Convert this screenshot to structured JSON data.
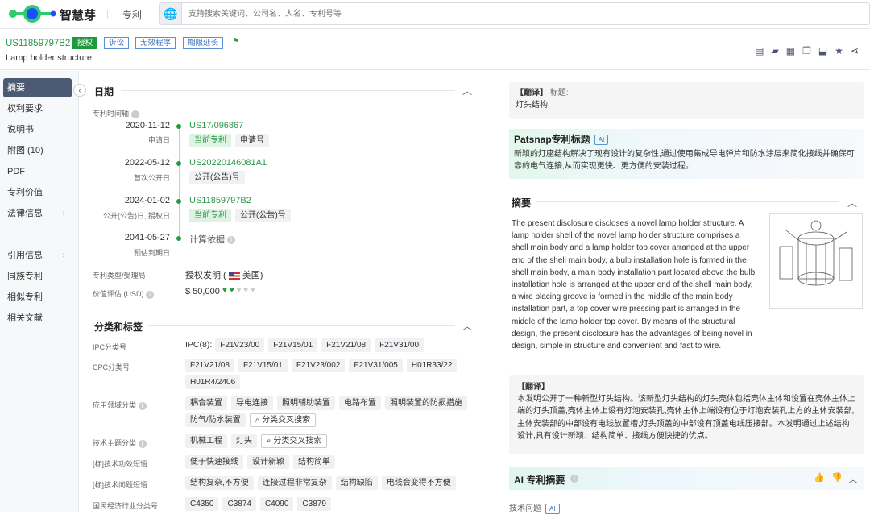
{
  "topbar": {
    "brand": "智慧芽",
    "module": "专利",
    "search_placeholder": "支持搜索关键词、公司名、人名、专利号等"
  },
  "header": {
    "patent_number": "US11859797B2",
    "tags": [
      "授权",
      "诉讼",
      "无效程序",
      "期限延长"
    ],
    "title": "Lamp holder structure"
  },
  "toolbar_icons": [
    "pdf-download-icon",
    "folder-icon",
    "document-icon",
    "copy-icon",
    "export-icon",
    "star-icon",
    "share-icon"
  ],
  "sidebar": {
    "items": [
      {
        "label": "摘要"
      },
      {
        "label": "权利要求"
      },
      {
        "label": "说明书"
      },
      {
        "label": "附图 (10)"
      },
      {
        "label": "PDF"
      },
      {
        "label": "专利价值"
      },
      {
        "label": "法律信息"
      },
      {
        "label": "引用信息"
      },
      {
        "label": "同族专利"
      },
      {
        "label": "相似专利"
      },
      {
        "label": "相关文献"
      }
    ]
  },
  "dates": {
    "heading": "日期",
    "timeline_label": "专利时间轴",
    "timeline": [
      {
        "date": "2020-11-12",
        "desc": "申请日",
        "number": "US17/096867",
        "chips": [
          "当前专利",
          "申请号"
        ]
      },
      {
        "date": "2022-05-12",
        "desc": "首次公开日",
        "number": "US20220146081A1",
        "chips": [
          "公开(公告)号"
        ]
      },
      {
        "date": "2024-01-02",
        "desc": "公开(公告)日, 授权日",
        "number": "US11859797B2",
        "chips": [
          "当前专利",
          "公开(公告)号"
        ]
      },
      {
        "date": "2041-05-27",
        "desc": "预估到期日",
        "number": "计算依据",
        "chips": []
      }
    ],
    "type_label": "专利类型/受理局",
    "type_value": "授权发明 (",
    "office": "美国)",
    "value_label": "价值评估 (USD)",
    "value": "$ 50,000",
    "value_rating": 1.5,
    "value_max": 5
  },
  "classification": {
    "heading": "分类和标签",
    "ipc_label": "IPC分类号",
    "ipc_prefix": "IPC(8):",
    "ipc": [
      "F21V23/00",
      "F21V15/01",
      "F21V21/08",
      "F21V31/00"
    ],
    "cpc_label": "CPC分类号",
    "cpc": [
      "F21V21/08",
      "F21V15/01",
      "F21V23/002",
      "F21V31/005",
      "H01R33/22",
      "H01R4/2406"
    ],
    "app_label": "应用领域分类",
    "app": [
      "耦合装置",
      "导电连接",
      "照明辅助装置",
      "电路布置",
      "照明装置的防损措施",
      "防气/防水装置"
    ],
    "cross_search": "分类交叉搜索",
    "topic_label": "技术主题分类",
    "topic": [
      "机械工程",
      "灯头"
    ],
    "effect_label": "[标]技术功效短语",
    "effect": [
      "便于快速接线",
      "设计新颖",
      "结构简单"
    ],
    "problem_label": "[标]技术问题短语",
    "problem": [
      "结构复杂,不方便",
      "连接过程非常复杂",
      "结构缺陷",
      "电线会变得不方便"
    ],
    "industry_label": "国民经济行业分类号",
    "industry": [
      "C4350",
      "C3874",
      "C4090",
      "C3879"
    ]
  },
  "right": {
    "trans_title_tag": "【翻译】",
    "trans_title_label": "标题:",
    "trans_title": "灯头结构",
    "patsnap_title": "Patsnap专利标题",
    "ai": "AI",
    "patsnap_text": "新颖的灯座结构解决了现有设计的复杂性,通过使用集成导电弹片和防水涂层来简化接线并确保可靠的电气连接,从而实现更快、更方便的安装过程。",
    "abstract_heading": "摘要",
    "abstract": "The present disclosure discloses a novel lamp holder structure. A lamp holder shell of the novel lamp holder structure comprises a shell main body and a lamp holder top cover arranged at the upper end of the shell main body, a bulb installation hole is formed in the shell main body, a main body installation part located above the bulb installation hole is arranged at the upper end of the shell main body, a wire placing groove is formed in the middle of the main body installation part, a top cover wire pressing part is arranged in the middle of the lamp holder top cover. By means of the structural design, the present disclosure has the advantages of being novel in design, simple in structure and convenient and fast to wire.",
    "trans_tag": "【翻译】",
    "trans_abstract": "本发明公开了一种新型灯头结构。该新型灯头结构的灯头壳体包括壳体主体和设置在壳体主体上端的灯头顶盖,壳体主体上设有灯泡安装孔,壳体主体上端设有位于灯泡安装孔上方的主体安装部,主体安装部的中部设有电线放置槽,灯头顶盖的中部设有顶盖电线压接部。本发明通过上述结构设计,具有设计新颖、结构简单、接线方便快捷的优点。",
    "ai_summary": "AI 专利摘要",
    "tech_problem": "技术问题"
  },
  "colors": {
    "accent": "#2b9a4a",
    "sidebar_active": "#4b5b74"
  }
}
